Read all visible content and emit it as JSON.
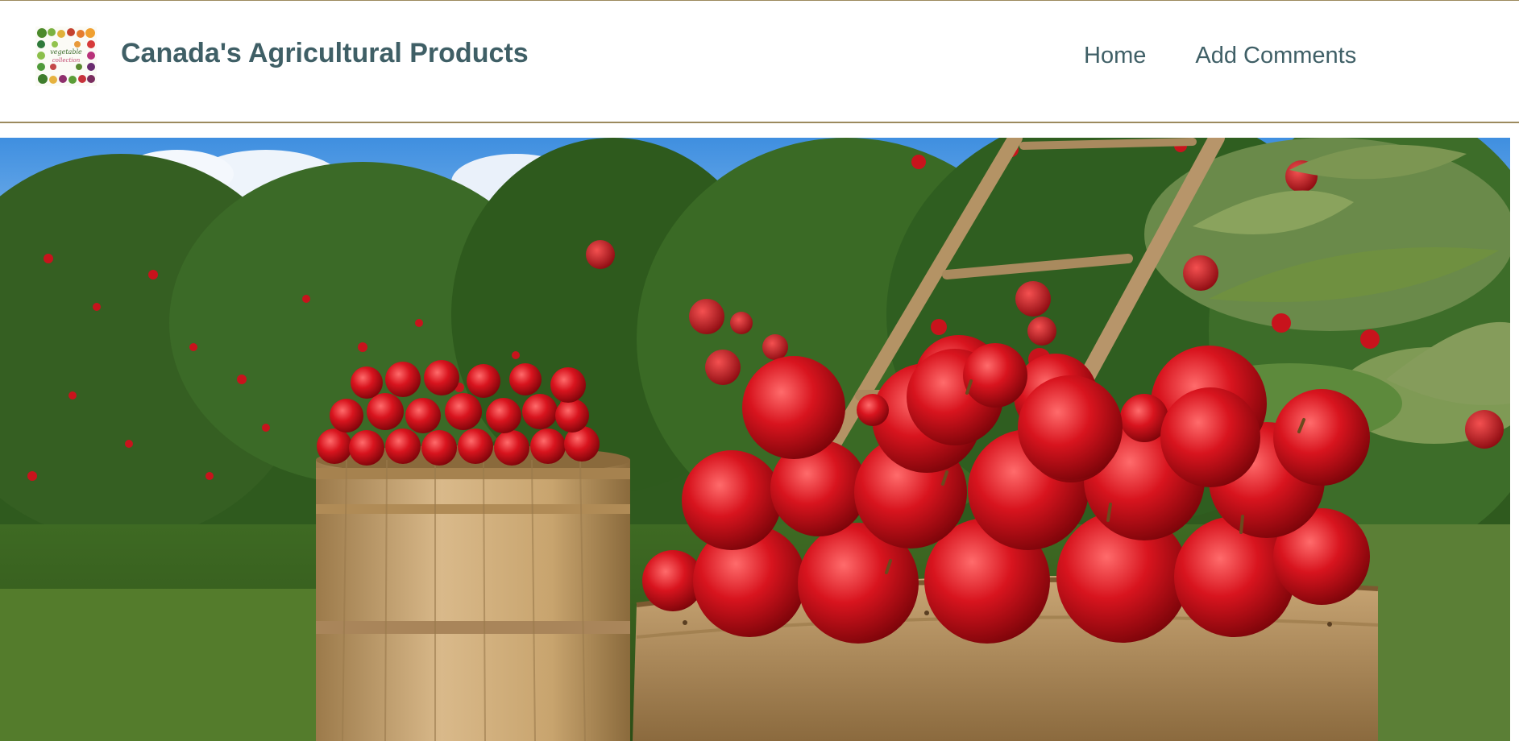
{
  "header": {
    "title": "Canada's Agricultural Products",
    "logo_icon": "vegetable-collection-logo"
  },
  "nav": {
    "items": [
      {
        "label": "Home"
      },
      {
        "label": "Add Comments"
      }
    ]
  },
  "hero": {
    "image": "apple-orchard-harvest-photo"
  },
  "colors": {
    "brand_text": "#3f5f66",
    "header_border": "#9c8a5e"
  }
}
